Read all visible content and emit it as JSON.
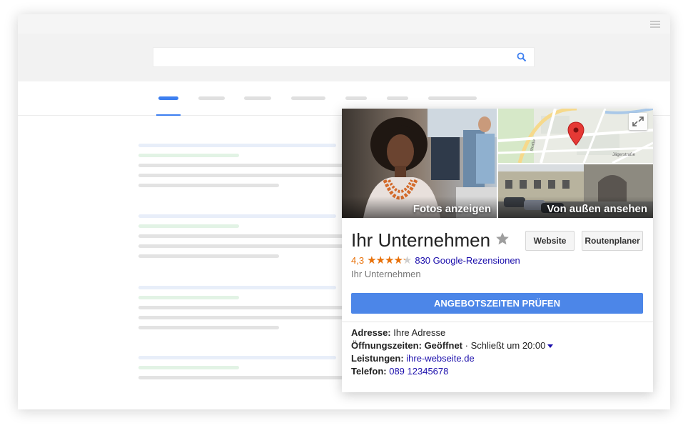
{
  "search": {
    "value": "",
    "placeholder": ""
  },
  "panel": {
    "photos_label": "Fotos anzeigen",
    "streetview_label": "Von außen ansehen",
    "business_name": "Ihr Unternehmen",
    "website_button": "Website",
    "route_button": "Routenplaner",
    "rating": "4,3",
    "stars": 4.3,
    "reviews_link": "830 Google-Rezensionen",
    "category": "Ihr Unternehmen",
    "cta": "ANGEBOTSZEITEN PRÜFEN",
    "address_label": "Adresse:",
    "address_value": "Ihre Adresse",
    "hours_label": "Öffnungszeiten:",
    "hours_status": "Geöffnet",
    "hours_sep": " · ",
    "hours_detail": "Schließt um 20:00",
    "services_label": "Leistungen:",
    "services_value": "ihre-webseite.de",
    "phone_label": "Telefon:",
    "phone_value": "089 12345678",
    "map_streets": [
      "straße",
      "Jägerstraße"
    ]
  },
  "colors": {
    "accent": "#4c86e8",
    "rating": "#e8710a",
    "link": "#1a0dab",
    "map_pin": "#e53935"
  },
  "icons": [
    "hamburger-menu-icon",
    "search-icon",
    "expand-icon",
    "star-outline-icon",
    "star-icon",
    "map-pin-icon",
    "dropdown-caret-icon"
  ]
}
